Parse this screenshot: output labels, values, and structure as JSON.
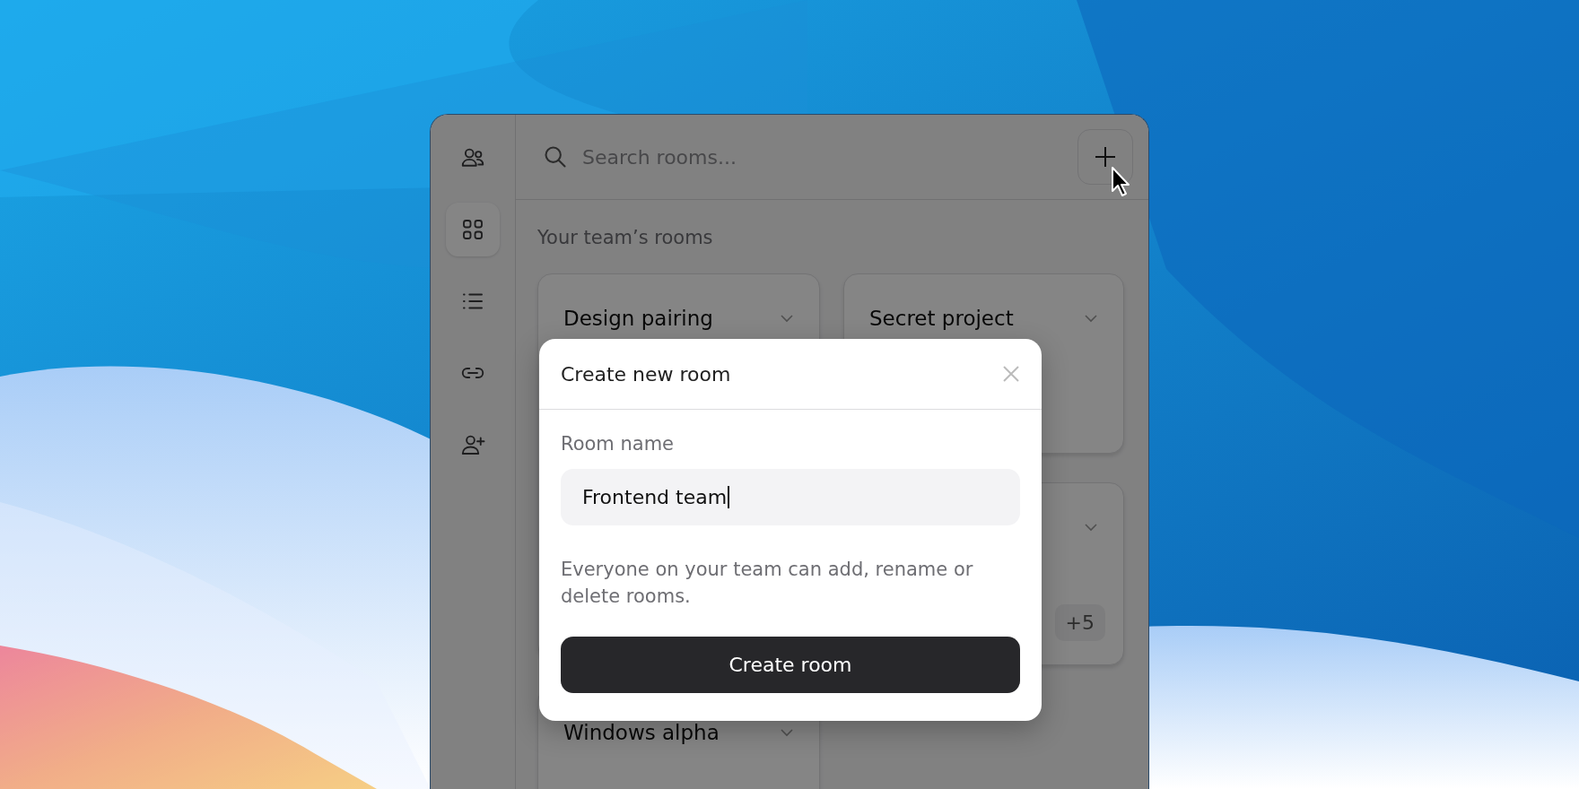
{
  "sidebar": {
    "items": [
      {
        "kind": "users",
        "selected": false
      },
      {
        "kind": "grid",
        "selected": true
      },
      {
        "kind": "list",
        "selected": false
      },
      {
        "kind": "link",
        "selected": false
      },
      {
        "kind": "user-plus",
        "selected": false
      }
    ]
  },
  "search": {
    "placeholder": "Search rooms..."
  },
  "section_title": "Your team’s rooms",
  "room_columns": [
    [
      {
        "title": "Design pairing"
      },
      {
        "title": "Windows alpha"
      }
    ],
    [
      {
        "title": "Secret project"
      },
      {
        "badge": "+5"
      }
    ]
  ],
  "dialog": {
    "title": "Create new room",
    "field_label": "Room name",
    "field_value": "Frontend team",
    "helper": "Everyone on your team can add, rename or delete rooms.",
    "submit": "Create room"
  }
}
